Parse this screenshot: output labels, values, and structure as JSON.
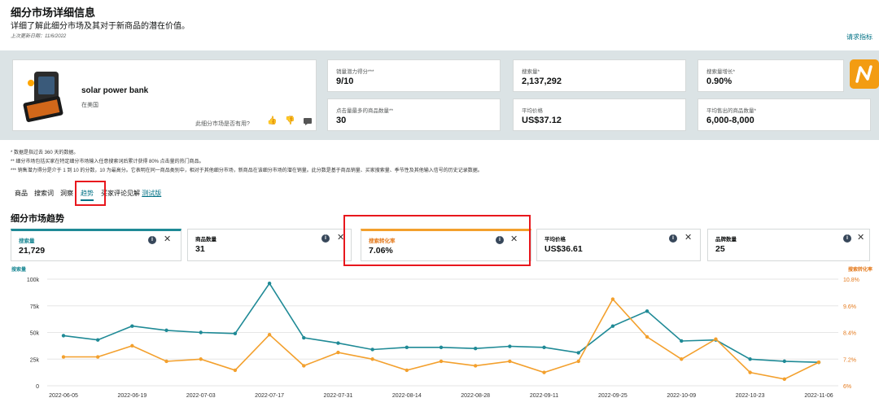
{
  "header": {
    "title": "细分市场详细信息",
    "subtitle": "详细了解此细分市场及其对于新商品的潜在价值。",
    "updated": "上次更新日期：11/6/2022",
    "request_link": "请求指标"
  },
  "product": {
    "name": "solar power bank",
    "region": "在美国",
    "helpful_question": "此细分市场是否有用?",
    "icons": [
      "thumbs-up-icon",
      "thumbs-down-icon",
      "comment-icon"
    ]
  },
  "metrics": [
    {
      "label": "销量潜力得分***",
      "value": "9/10"
    },
    {
      "label": "搜索量*",
      "value": "2,137,292"
    },
    {
      "label": "搜索量增长*",
      "value": "0.90%"
    },
    {
      "label": "点击量最多的商品数量**",
      "value": "30"
    },
    {
      "label": "平均价格",
      "value": "US$37.12"
    },
    {
      "label": "平均售出的商品数量*",
      "value": "6,000-8,000"
    }
  ],
  "footnotes": [
    "* 数据是指过去 360 天的数据。",
    "** 细分市场包括买家在特定细分市场输入任意搜索词后累计获得 80% 点击量的热门商品。",
    "*** 销售潜力得分是介于 1 到 10 的分数，10 为最高分。它表明在同一商品类别中，相对于其他细分市场，新商品在该细分市场的潜在销量。此分数是基于商品销量、买家搜索量、季节性及其他输入信号的历史记录数据。"
  ],
  "tabs": [
    {
      "label": "商品"
    },
    {
      "label": "搜索词"
    },
    {
      "label": "洞察"
    },
    {
      "label": "趋势"
    },
    {
      "label": "买家评论见解"
    }
  ],
  "beta_label": "测试版",
  "section_title": "细分市场趋势",
  "trend_cards": [
    {
      "label": "搜索量",
      "value": "21,729"
    },
    {
      "label": "商品数量",
      "value": "31"
    },
    {
      "label": "搜索转化率",
      "value": "7.06%"
    },
    {
      "label": "平均价格",
      "value": "US$36.61"
    },
    {
      "label": "品牌数量",
      "value": "25"
    }
  ],
  "colors": {
    "teal": "#1f8a96",
    "orange": "#f3a02d",
    "highlight": "#e8171d"
  },
  "chart_data": {
    "type": "line",
    "left_axis_label": "搜索量",
    "right_axis_label": "搜索转化率",
    "left_ticks": [
      "100k",
      "75k",
      "50k",
      "25k",
      "0"
    ],
    "right_ticks": [
      "10.8%",
      "9.6%",
      "8.4%",
      "7.2%",
      "6%"
    ],
    "left_ylim": [
      0,
      100000
    ],
    "right_ylim": [
      6.0,
      10.8
    ],
    "x_labels": [
      "2022-06-05",
      "2022-06-19",
      "2022-07-03",
      "2022-07-17",
      "2022-07-31",
      "2022-08-14",
      "2022-08-28",
      "2022-09-11",
      "2022-09-25",
      "2022-10-09",
      "2022-10-23",
      "2022-11-06"
    ],
    "x": [
      "2022-06-05",
      "2022-06-12",
      "2022-06-19",
      "2022-06-26",
      "2022-07-03",
      "2022-07-10",
      "2022-07-17",
      "2022-07-24",
      "2022-07-31",
      "2022-08-07",
      "2022-08-14",
      "2022-08-21",
      "2022-08-28",
      "2022-09-04",
      "2022-09-11",
      "2022-09-18",
      "2022-09-25",
      "2022-10-02",
      "2022-10-09",
      "2022-10-16",
      "2022-10-23",
      "2022-10-30",
      "2022-11-06"
    ],
    "series": [
      {
        "name": "搜索量",
        "axis": "left",
        "color": "#1f8a96",
        "values": [
          47000,
          43000,
          56000,
          52000,
          50000,
          49000,
          96000,
          45000,
          40000,
          34000,
          36000,
          36000,
          35000,
          37000,
          36000,
          31000,
          56000,
          70000,
          42000,
          43000,
          25000,
          23000,
          22000
        ]
      },
      {
        "name": "搜索转化率",
        "axis": "right",
        "color": "#f3a02d",
        "values": [
          7.3,
          7.3,
          7.8,
          7.1,
          7.2,
          6.7,
          8.3,
          6.9,
          7.5,
          7.2,
          6.7,
          7.1,
          6.9,
          7.1,
          6.6,
          7.1,
          9.9,
          8.2,
          7.2,
          8.1,
          6.6,
          6.3,
          7.06
        ]
      }
    ]
  }
}
